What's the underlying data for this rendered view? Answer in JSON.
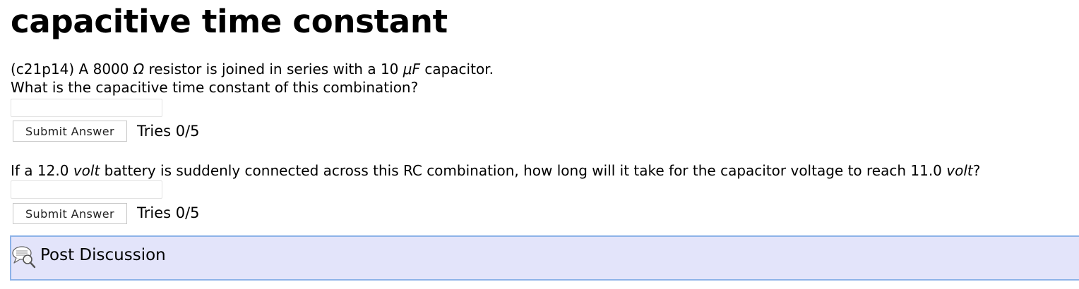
{
  "page_title": "capacitive time constant",
  "problem1": {
    "intro": {
      "prefix": "(c21p14) A 8000 ",
      "resistance_unit": "Ω",
      "middle": " resistor is joined in series with a 10 ",
      "capacitance_unit": "μF",
      "suffix": " capacitor."
    },
    "question": "What is the capacitive time constant of this combination?",
    "answer_value": "",
    "submit_label": "Submit Answer",
    "tries": "Tries 0/5"
  },
  "problem2": {
    "question": {
      "prefix": "If a 12.0 ",
      "unit1": "volt",
      "middle": " battery is suddenly connected across this RC combination, how long will it take for the capacitor voltage to reach 11.0 ",
      "unit2": "volt",
      "suffix": "?"
    },
    "answer_value": "",
    "submit_label": "Submit Answer",
    "tries": "Tries 0/5"
  },
  "discussion": {
    "label": "Post Discussion",
    "icon": "discussion-icon"
  }
}
